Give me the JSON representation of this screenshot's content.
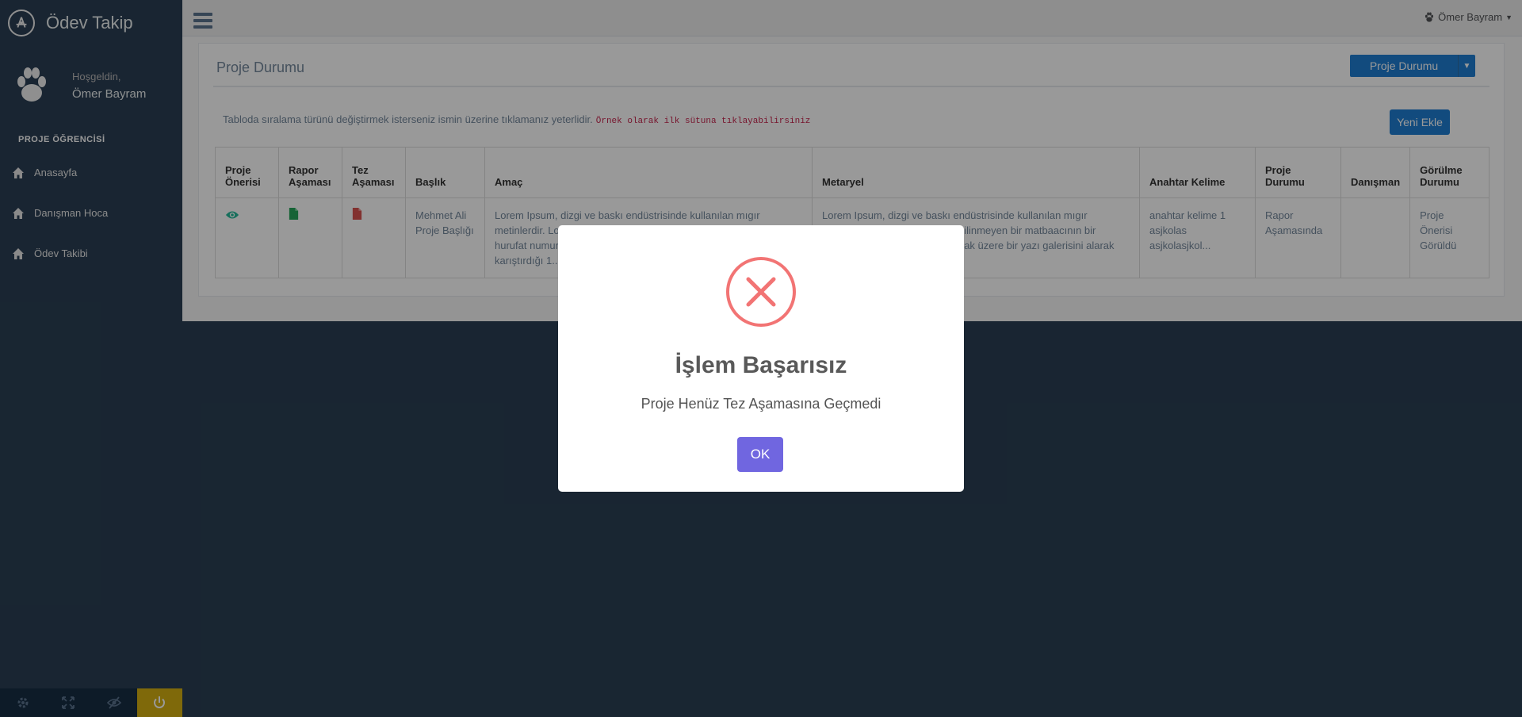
{
  "app": {
    "title": "Ödev Takip"
  },
  "profile": {
    "welcome": "Hoşgeldin,",
    "name": "Ömer Bayram"
  },
  "sidebar": {
    "section_title": "PROJE ÖĞRENCİSİ",
    "items": [
      {
        "label": "Anasayfa",
        "icon": "home-icon"
      },
      {
        "label": "Danışman Hoca",
        "icon": "home-icon"
      },
      {
        "label": "Ödev Takibi",
        "icon": "home-icon"
      }
    ],
    "footer_icons": [
      "settings-icon",
      "fullscreen-icon",
      "eye-slash-icon",
      "power-icon"
    ]
  },
  "topnav": {
    "user": "Ömer Bayram"
  },
  "panel": {
    "title": "Proje Durumu",
    "dropdown_label": "Proje Durumu",
    "hint": "Tabloda sıralama türünü değiştirmek isterseniz ismin üzerine tıklamanız yeterlidir.",
    "hint_code": "Örnek olarak ilk sütuna tıklayabilirsiniz",
    "add_button": "Yeni Ekle"
  },
  "table": {
    "headers": [
      "Proje Önerisi",
      "Rapor Aşaması",
      "Tez Aşaması",
      "Başlık",
      "Amaç",
      "Metaryel",
      "Anahtar Kelime",
      "Proje Durumu",
      "Danışman",
      "Görülme Durumu"
    ],
    "row": {
      "baslik": "Mehmet Ali Proje Başlığı",
      "amac": "Lorem Ipsum, dizgi ve baskı endüstrisinde kullanılan mıgır metinlerdir. Lorem Ipsum, adı bilinmeyen bir matbaacının bir hurufat numune kitabı oluşturmak üzere bir yazı galerisini alarak karıştırdığı 1...",
      "metaryel": "Lorem Ipsum, dizgi ve baskı endüstrisinde kullanılan mıgır metinlerdir. Lorem Ipsum, adı bilinmeyen bir matbaacının bir hurufat numune kitabı oluşturmak üzere bir yazı galerisini alarak",
      "anahtar": "anahtar kelime 1 asjkolas asjkolasjkol...",
      "durum": "Rapor Aşamasında",
      "danisman": "",
      "gorulme": "Proje Önerisi Görüldü"
    }
  },
  "modal": {
    "title": "İşlem Başarısız",
    "message": "Proje Henüz Tez Aşamasına Geçmedi",
    "ok": "OK"
  },
  "colors": {
    "sidebar": "#2a3f54",
    "primary": "#1f7ed2",
    "confirm": "#7066e0",
    "error": "#f27474",
    "power": "#d4b012"
  }
}
